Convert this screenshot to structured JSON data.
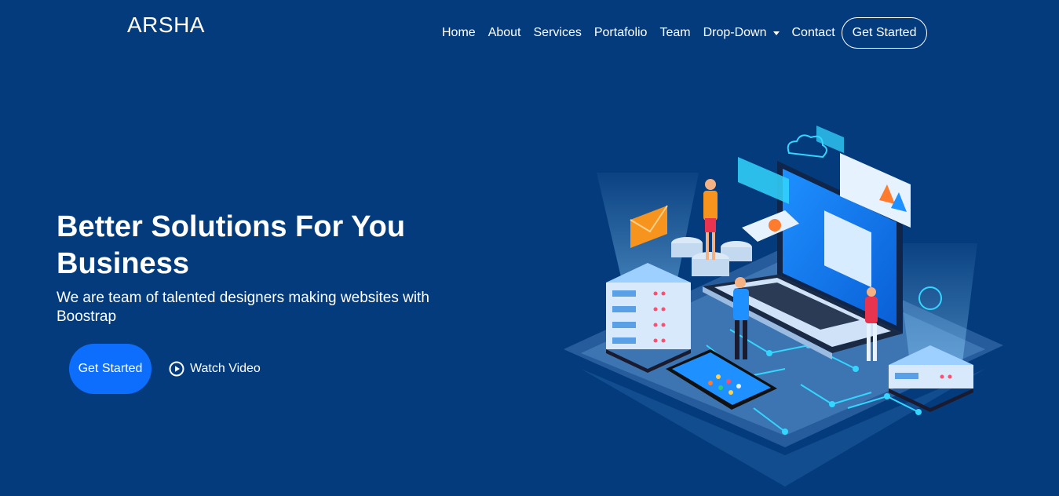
{
  "header": {
    "logo": "ARSHA",
    "nav": [
      "Home",
      "About",
      "Services",
      "Portafolio",
      "Team",
      "Drop-Down",
      "Contact"
    ],
    "cta": "Get Started"
  },
  "hero": {
    "title": "Better Solutions For You Business",
    "subtitle": "We are team of talented designers making websites with Boostrap",
    "primary_button": "Get Started",
    "video_link": "Watch Video"
  },
  "icons": {
    "dropdown": "chevron-down-icon",
    "video": "play-circle-icon"
  },
  "colors": {
    "background": "#043b7c",
    "primary_button": "#0d6efd",
    "text": "#ffffff"
  }
}
